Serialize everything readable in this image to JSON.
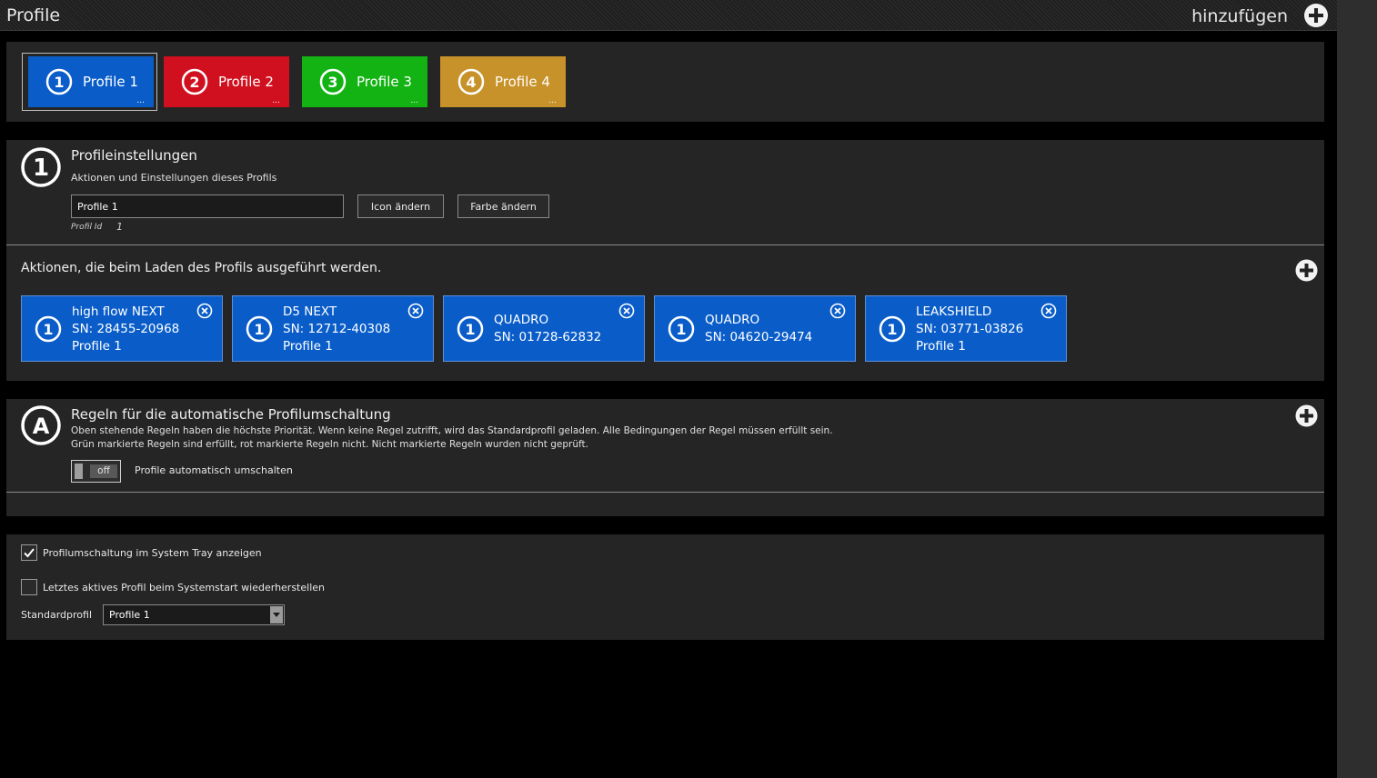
{
  "window": {
    "title": "Profile",
    "add_label": "hinzufügen"
  },
  "profiles": [
    {
      "number": "1",
      "label": "Profile 1",
      "color": "#0a5dc9",
      "selected": true
    },
    {
      "number": "2",
      "label": "Profile 2",
      "color": "#d0101e",
      "selected": false
    },
    {
      "number": "3",
      "label": "Profile 3",
      "color": "#13b313",
      "selected": false
    },
    {
      "number": "4",
      "label": "Profile 4",
      "color": "#c7922a",
      "selected": false
    }
  ],
  "tile_more": "...",
  "settings": {
    "title": "Profileinstellungen",
    "subtitle": "Aktionen und Einstellungen dieses Profils",
    "name_value": "Profile 1",
    "icon_button": "Icon ändern",
    "color_button": "Farbe ändern",
    "profile_id_label": "Profil Id",
    "profile_id_value": "1",
    "icon_number": "1"
  },
  "actions": {
    "title": "Aktionen, die beim Laden des Profils ausgeführt werden.",
    "cards": [
      {
        "line1": "high flow NEXT",
        "line2": "SN: 28455-20968",
        "line3": "Profile 1"
      },
      {
        "line1": "D5 NEXT",
        "line2": "SN: 12712-40308",
        "line3": "Profile 1"
      },
      {
        "line1": "QUADRO",
        "line2": "SN: 01728-62832",
        "line3": ""
      },
      {
        "line1": "QUADRO",
        "line2": "SN: 04620-29474",
        "line3": ""
      },
      {
        "line1": "LEAKSHIELD",
        "line2": "SN: 03771-03826",
        "line3": "Profile 1"
      }
    ]
  },
  "rules": {
    "icon_letter": "A",
    "title": "Regeln für die automatische Profilumschaltung",
    "desc1": "Oben stehende Regeln haben die höchste Priorität. Wenn keine Regel zutrifft, wird das Standardprofil geladen. Alle Bedingungen der Regel müssen erfüllt sein.",
    "desc2": "Grün markierte Regeln sind erfüllt, rot markierte Regeln nicht. Nicht markierte Regeln wurden nicht geprüft.",
    "toggle_state": "off",
    "toggle_label": "Profile automatisch umschalten"
  },
  "options": {
    "tray_label": "Profilumschaltung im System Tray anzeigen",
    "tray_checked": true,
    "restore_label": "Letztes aktives Profil beim Systemstart wiederherstellen",
    "restore_checked": false,
    "default_label": "Standardprofil",
    "default_value": "Profile 1"
  },
  "icons": {
    "add": "plus-circle-icon",
    "remove": "close-circle-icon",
    "check": "checkmark-icon"
  }
}
